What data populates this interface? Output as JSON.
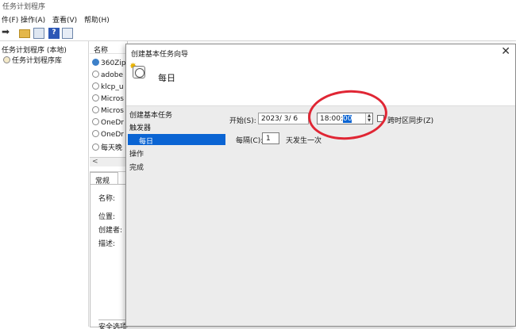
{
  "app": {
    "title": "任务计划程序",
    "menu": [
      "件(F)",
      "操作(A)",
      "查看(V)",
      "帮助(H)"
    ]
  },
  "tree": {
    "root": "任务计划程序 (本地)",
    "library": "任务计划程序库"
  },
  "list": {
    "header": "名称",
    "rows": [
      "360Zip",
      "adobe",
      "klcp_u",
      "Micros",
      "Micros",
      "OneDr",
      "OneDr",
      "每天晚"
    ]
  },
  "detail": {
    "tab": "常规",
    "labels": [
      "名称:",
      "位置:",
      "创建者:",
      "描述:"
    ],
    "security": "安全选项"
  },
  "wizard": {
    "title": "创建基本任务向导",
    "heading": "每日",
    "close_glyph": "✕",
    "nav": [
      "创建基本任务",
      "触发器",
      "每日",
      "操作",
      "完成"
    ],
    "start_label": "开始(S):",
    "date_value": "2023/ 3/ 6",
    "time_main": "18:00:",
    "time_seconds": "00",
    "sync_label": "跨时区同步(Z)",
    "every_label": "每隔(C):",
    "every_value": "1",
    "every_suffix": "天发生一次"
  },
  "icons": {
    "back": "arrow-icon",
    "folder": "folder-icon",
    "help": "help-icon",
    "panel": "panel-icon"
  },
  "colors": {
    "selection": "#0a64d3",
    "annotation_circle": "#e02634"
  }
}
